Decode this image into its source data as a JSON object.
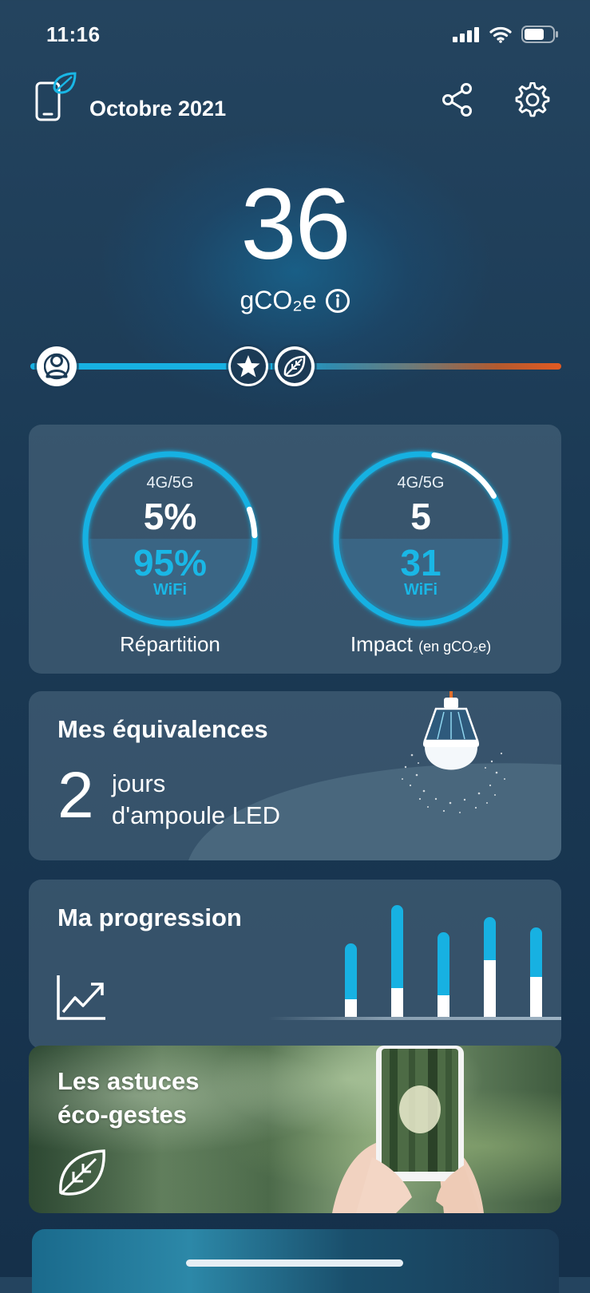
{
  "status_bar": {
    "time": "11:16"
  },
  "header": {
    "month": "Octobre 2021"
  },
  "summary": {
    "value": "36",
    "unit": "gCO₂e"
  },
  "slider": {
    "level": 0.41
  },
  "distribution": {
    "left": {
      "top_label": "4G/5G",
      "top_value": "5%",
      "bottom_value": "95%",
      "bottom_label": "WiFi",
      "caption": "Répartition",
      "mobile_fraction": 0.05
    },
    "right": {
      "top_label": "4G/5G",
      "top_value": "5",
      "bottom_value": "31",
      "bottom_label": "WiFi",
      "caption": "Impact",
      "caption_small": "(en gCO₂e)",
      "mobile_fraction": 0.14
    }
  },
  "equivalences": {
    "title": "Mes équivalences",
    "number": "2",
    "line1": "jours",
    "line2": "d'ampoule LED"
  },
  "progression": {
    "title": "Ma progression",
    "bars": [
      {
        "total": 0.66,
        "white": 0.16
      },
      {
        "total": 1.0,
        "white": 0.26
      },
      {
        "total": 0.76,
        "white": 0.19
      },
      {
        "total": 0.89,
        "white": 0.51
      },
      {
        "total": 0.8,
        "white": 0.36
      }
    ]
  },
  "tips": {
    "line1": "Les astuces",
    "line2": "éco-gestes"
  },
  "colors": {
    "accent": "#17b1e2",
    "warning": "#e25a22",
    "background": "#1b3a55"
  }
}
